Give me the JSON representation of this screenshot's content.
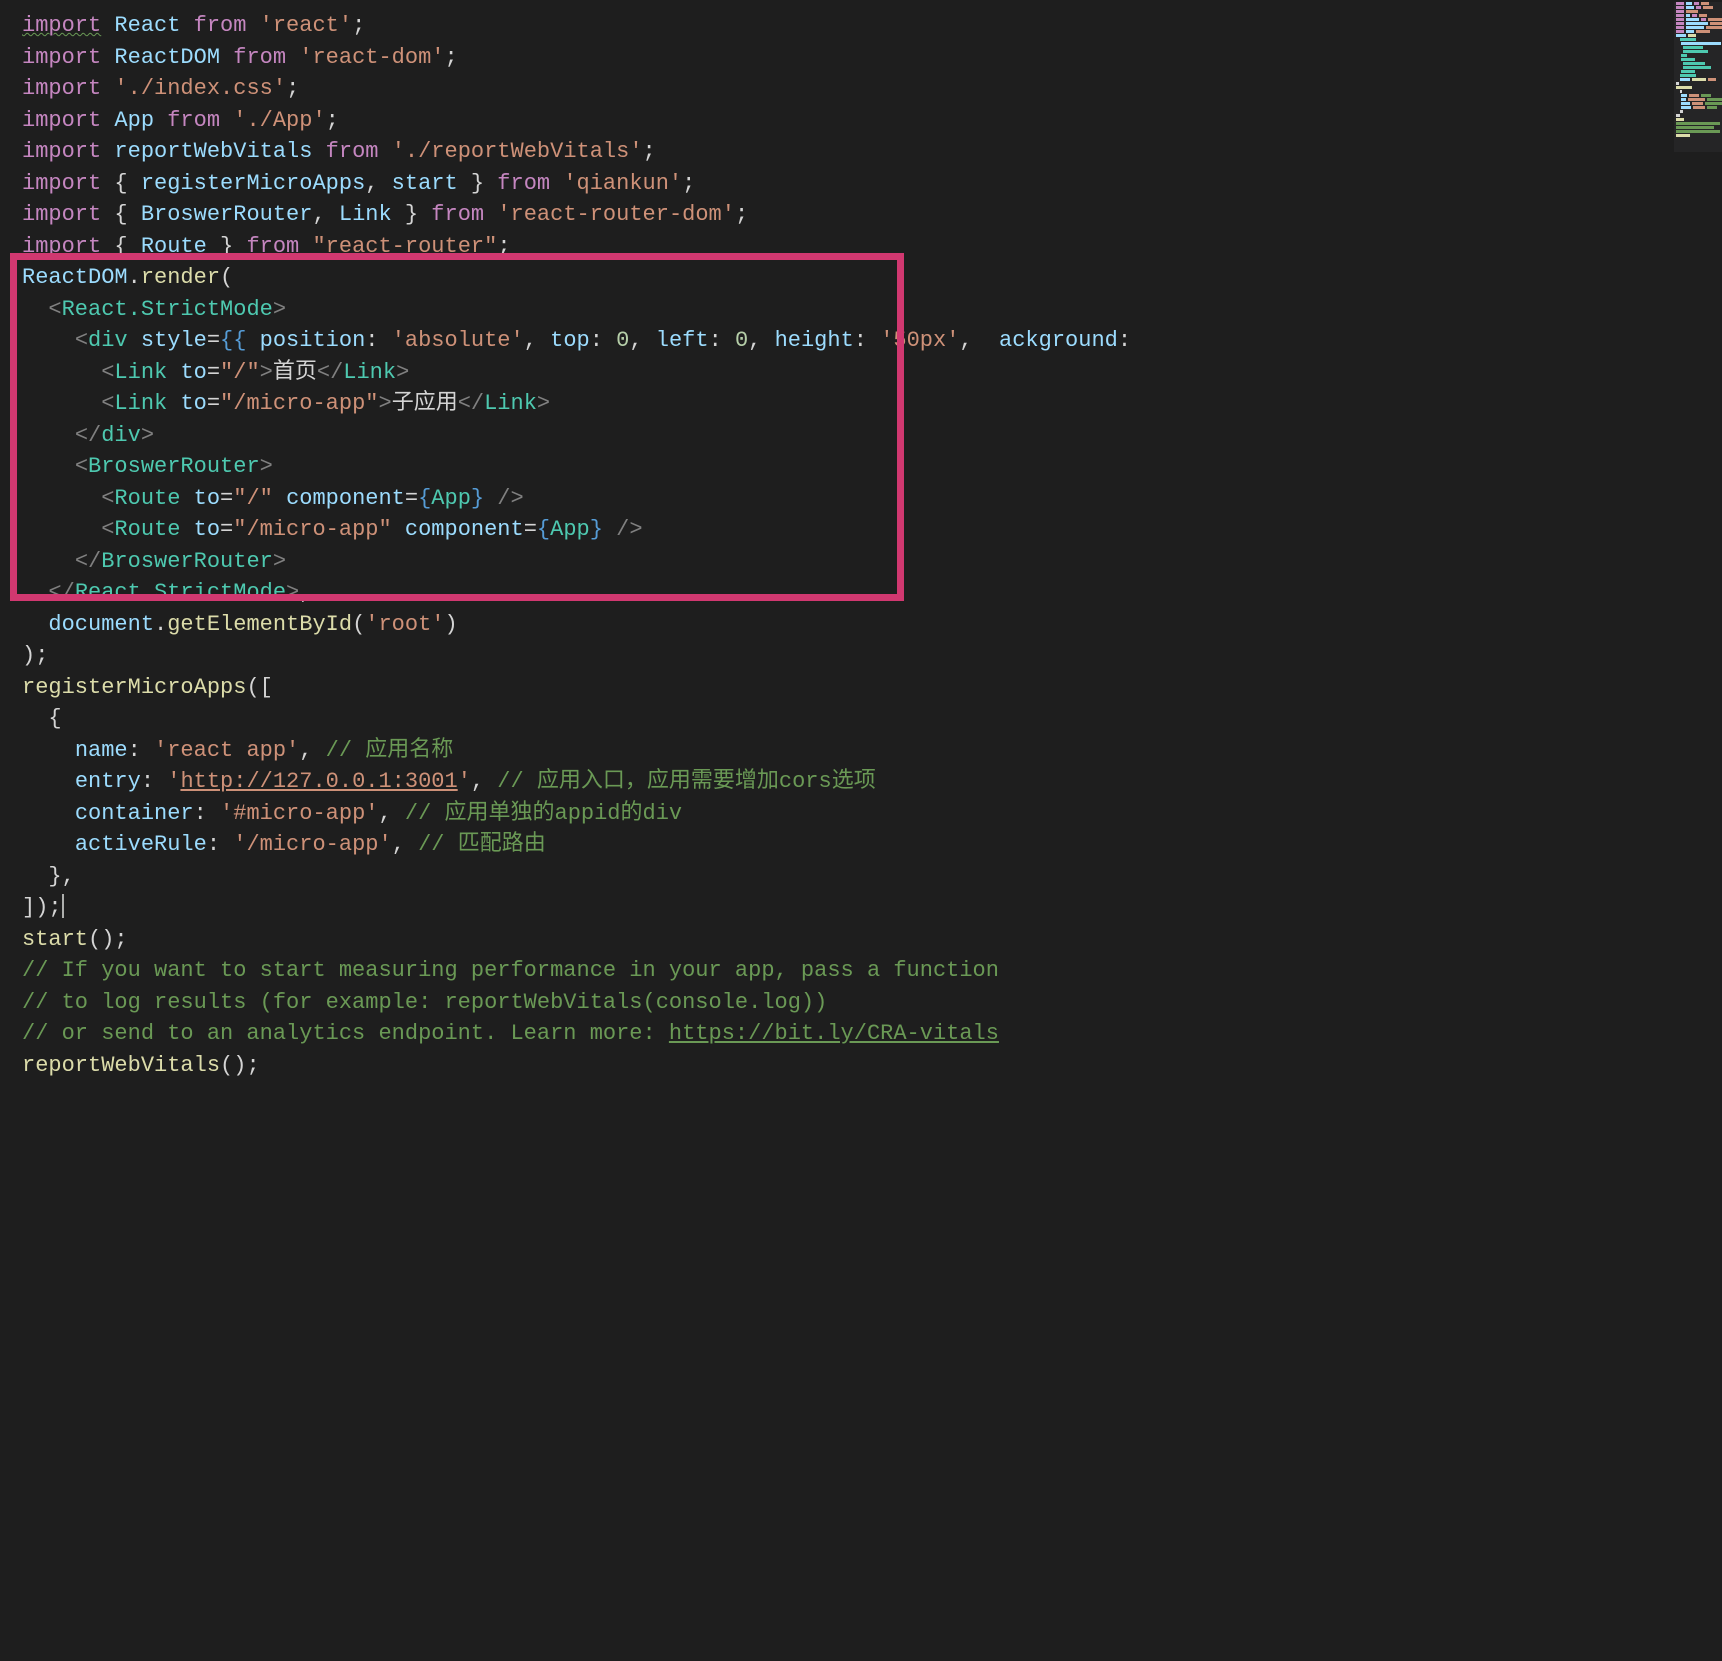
{
  "code": {
    "l1": {
      "kw": "import",
      "v": "React",
      "from": "from",
      "s": "'react'",
      "p": ";"
    },
    "l2": {
      "kw": "import",
      "v": "ReactDOM",
      "from": "from",
      "s": "'react-dom'",
      "p": ";"
    },
    "l3": {
      "kw": "import",
      "s": "'./index.css'",
      "p": ";"
    },
    "l4": {
      "kw": "import",
      "v": "App",
      "from": "from",
      "s": "'./App'",
      "p": ";"
    },
    "l5": {
      "kw": "import",
      "v": "reportWebVitals",
      "from": "from",
      "s": "'./reportWebVitals'",
      "p": ";"
    },
    "l6": {
      "kw": "import",
      "b1": "{",
      "v1": "registerMicroApps",
      "c": ",",
      "v2": "start",
      "b2": "}",
      "from": "from",
      "s": "'qiankun'",
      "p": ";"
    },
    "l7": {
      "kw": "import",
      "b1": "{",
      "v1": "BroswerRouter",
      "c": ",",
      "v2": "Link",
      "b2": "}",
      "from": "from",
      "s": "'react-router-dom'",
      "p": ";"
    },
    "l8": {
      "kw": "import",
      "b1": "{",
      "v1": "Route",
      "b2": "}",
      "from": "from",
      "s": "\"react-router\"",
      "p": ";"
    },
    "l9": {
      "obj": "ReactDOM",
      "dot": ".",
      "fn": "render",
      "paren": "("
    },
    "l10": {
      "lt": "<",
      "tag": "React.StrictMode",
      "gt": ">"
    },
    "l11": {
      "lt": "<",
      "tag": "div",
      "attr": "style",
      "eq": "=",
      "ob": "{{",
      "p1": "position",
      "s1": "'absolute'",
      "p2": "top",
      "n1": "0",
      "p3": "left",
      "n2": "0",
      "p4": "height",
      "s2": "'50px'",
      "p5": "ackground",
      "colon": ":",
      "comma": ", "
    },
    "l12": {
      "lt": "<",
      "tag": "Link",
      "attr": "to",
      "eq": "=",
      "s": "\"/\"",
      "gt": ">",
      "txt": "首页",
      "lt2": "</",
      "tag2": "Link",
      "gt2": ">"
    },
    "l13": {
      "lt": "<",
      "tag": "Link",
      "attr": "to",
      "eq": "=",
      "s": "\"/micro-app\"",
      "gt": ">",
      "txt": "子应用",
      "lt2": "</",
      "tag2": "Link",
      "gt2": ">"
    },
    "l14": {
      "lt": "</",
      "tag": "div",
      "gt": ">"
    },
    "l15": {
      "lt": "<",
      "tag": "BroswerRouter",
      "gt": ">"
    },
    "l16": {
      "lt": "<",
      "tag": "Route",
      "attr1": "to",
      "eq": "=",
      "s1": "\"/\"",
      "attr2": "component",
      "ob": "{",
      "v": "App",
      "cb": "}",
      "end": " />"
    },
    "l17": {
      "lt": "<",
      "tag": "Route",
      "attr1": "to",
      "eq": "=",
      "s1": "\"/micro-app\"",
      "attr2": "component",
      "ob": "{",
      "v": "App",
      "cb": "}",
      "end": " />"
    },
    "l18": {
      "lt": "</",
      "tag": "BroswerRouter",
      "gt": ">"
    },
    "l19": {
      "lt": "</",
      "tag": "React.StrictMode",
      "gt": ">",
      "c": ","
    },
    "l20": {
      "obj": "document",
      "dot": ".",
      "fn": "getElementById",
      "p1": "(",
      "s": "'root'",
      "p2": ")"
    },
    "l21": {
      "p": ");"
    },
    "l22": {
      "fn": "registerMicroApps",
      "p1": "([",
      "end": ""
    },
    "l23": {
      "b": "{"
    },
    "l24": {
      "prop": "name",
      "colon": ": ",
      "s": "'react app'",
      "c": ",",
      "cm": " // 应用名称"
    },
    "l25": {
      "prop": "entry",
      "colon": ": ",
      "s": "'http://127.0.0.1:3001'",
      "c": ",",
      "cm": " // 应用入口，应用需要增加cors选项"
    },
    "l26": {
      "prop": "container",
      "colon": ": ",
      "s": "'#micro-app'",
      "c": ",",
      "cm": " // 应用单独的appid的div"
    },
    "l27": {
      "prop": "activeRule",
      "colon": ": ",
      "s": "'/micro-app'",
      "c": ",",
      "cm": " // 匹配路由"
    },
    "l28": {
      "b": "},"
    },
    "l29": {
      "p": "]);"
    },
    "l30": {
      "fn": "start",
      "p": "();"
    },
    "l31": {
      "cm": "// If you want to start measuring performance in your app, pass a function"
    },
    "l32": {
      "cm": "// to log results (for example: reportWebVitals(console.log))"
    },
    "l33": {
      "cm": "// or send to an analytics endpoint. Learn more: ",
      "link": "https://bit.ly/CRA-vitals"
    },
    "l34": {
      "fn": "reportWebVitals",
      "p": "();"
    }
  }
}
